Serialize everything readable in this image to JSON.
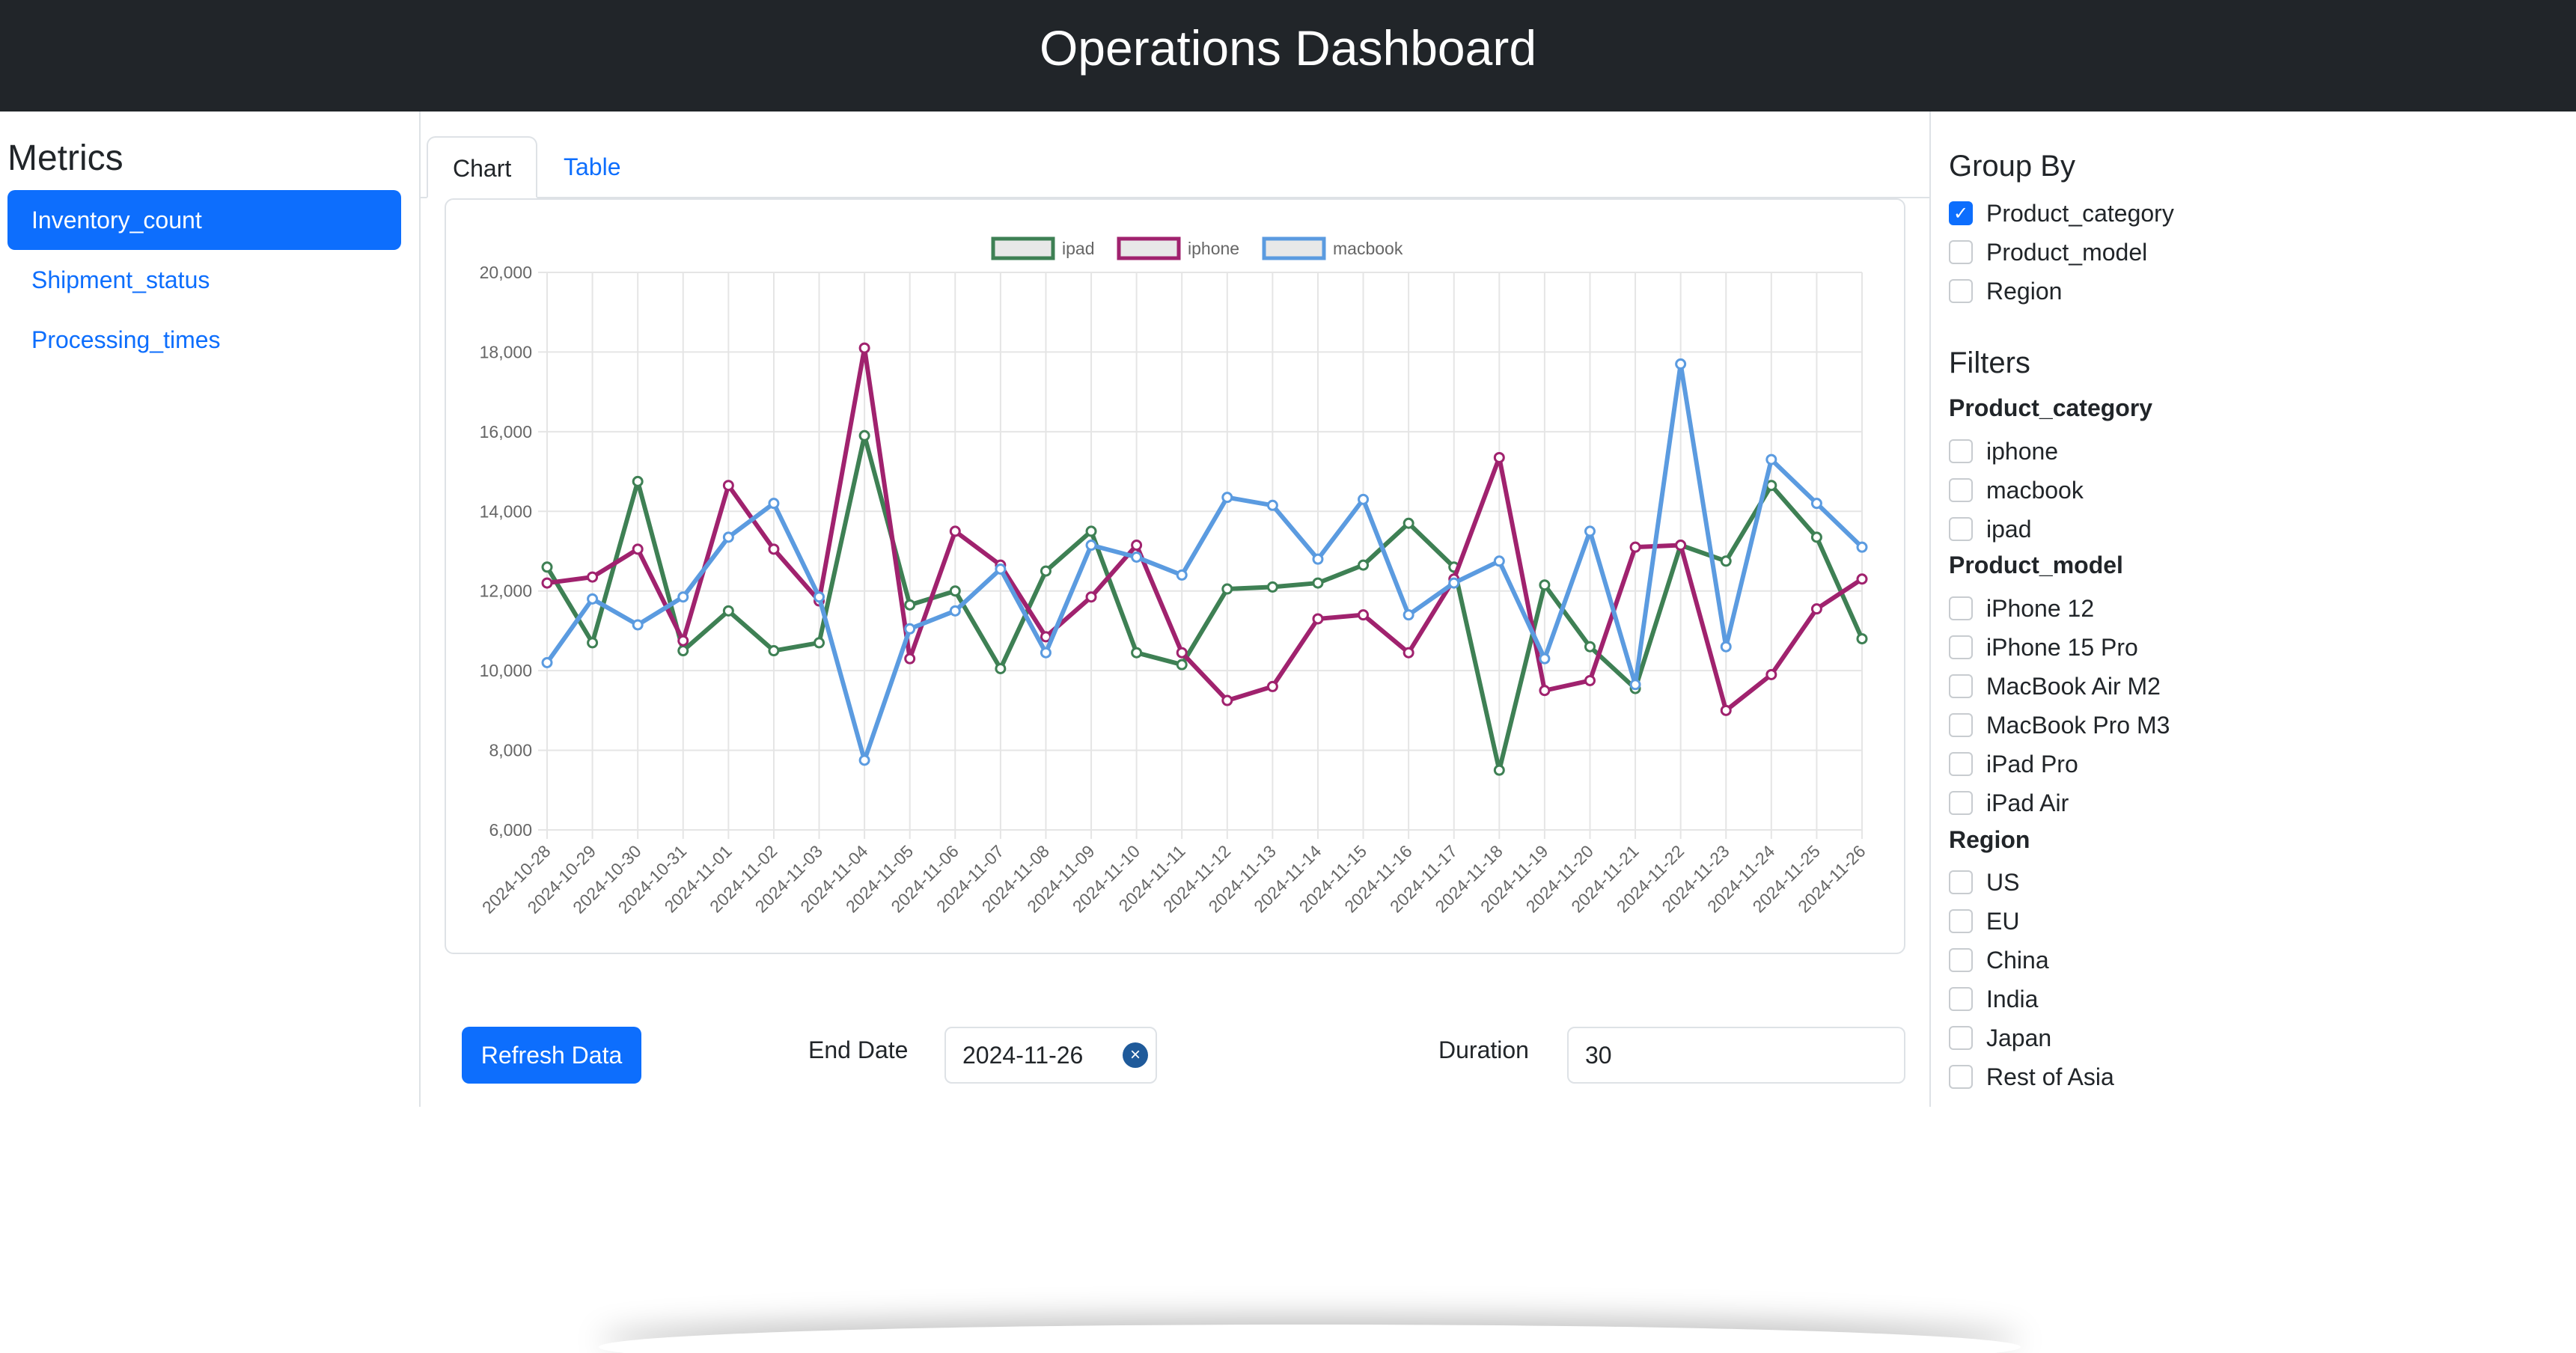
{
  "header": {
    "title": "Operations Dashboard"
  },
  "sidebar": {
    "heading": "Metrics",
    "items": [
      {
        "label": "Inventory_count",
        "active": true
      },
      {
        "label": "Shipment_status",
        "active": false
      },
      {
        "label": "Processing_times",
        "active": false
      }
    ]
  },
  "tabs": [
    {
      "label": "Chart",
      "active": true
    },
    {
      "label": "Table",
      "active": false
    }
  ],
  "controls": {
    "refresh_label": "Refresh Data",
    "end_date_label": "End Date",
    "end_date_value": "2024-11-26",
    "duration_label": "Duration",
    "duration_value": "30"
  },
  "group_by": {
    "title": "Group By",
    "options": [
      {
        "label": "Product_category",
        "checked": true
      },
      {
        "label": "Product_model",
        "checked": false
      },
      {
        "label": "Region",
        "checked": false
      }
    ]
  },
  "filters": {
    "title": "Filters",
    "groups": [
      {
        "name": "Product_category",
        "options": [
          "iphone",
          "macbook",
          "ipad"
        ]
      },
      {
        "name": "Product_model",
        "options": [
          "iPhone 12",
          "iPhone 15 Pro",
          "MacBook Air M2",
          "MacBook Pro M3",
          "iPad Pro",
          "iPad Air"
        ]
      },
      {
        "name": "Region",
        "options": [
          "US",
          "EU",
          "China",
          "India",
          "Japan",
          "Rest of Asia"
        ]
      }
    ]
  },
  "chart_data": {
    "type": "line",
    "legend_position": "top-center",
    "grid": true,
    "ylim": [
      6000,
      20000
    ],
    "y_ticks": [
      "6,000",
      "8,000",
      "10,000",
      "12,000",
      "14,000",
      "16,000",
      "18,000",
      "20,000"
    ],
    "y_tick_values": [
      6000,
      8000,
      10000,
      12000,
      14000,
      16000,
      18000,
      20000
    ],
    "x": [
      "2024-10-28",
      "2024-10-29",
      "2024-10-30",
      "2024-10-31",
      "2024-11-01",
      "2024-11-02",
      "2024-11-03",
      "2024-11-04",
      "2024-11-05",
      "2024-11-06",
      "2024-11-07",
      "2024-11-08",
      "2024-11-09",
      "2024-11-10",
      "2024-11-11",
      "2024-11-12",
      "2024-11-13",
      "2024-11-14",
      "2024-11-15",
      "2024-11-16",
      "2024-11-17",
      "2024-11-18",
      "2024-11-19",
      "2024-11-20",
      "2024-11-21",
      "2024-11-22",
      "2024-11-23",
      "2024-11-24",
      "2024-11-25",
      "2024-11-26"
    ],
    "series": [
      {
        "name": "ipad",
        "color": "#3e8054",
        "values": [
          12600,
          10700,
          14750,
          10500,
          11500,
          10500,
          10700,
          15900,
          11650,
          12000,
          10050,
          12500,
          13500,
          10450,
          10150,
          12050,
          12100,
          12200,
          12650,
          13700,
          12600,
          7500,
          12150,
          10600,
          9550,
          13150,
          12750,
          14650,
          13350,
          10800
        ]
      },
      {
        "name": "iphone",
        "color": "#a0226e",
        "values": [
          12200,
          12350,
          13050,
          10750,
          14650,
          13050,
          11750,
          18100,
          10300,
          13500,
          12650,
          10850,
          11850,
          13150,
          10450,
          9250,
          9600,
          11300,
          11400,
          10450,
          12300,
          15350,
          9500,
          9750,
          13100,
          13150,
          9000,
          9900,
          11550,
          12300
        ]
      },
      {
        "name": "macbook",
        "color": "#5b9be0",
        "values": [
          10200,
          11800,
          11150,
          11850,
          13350,
          14200,
          11850,
          7750,
          11050,
          11500,
          12550,
          10450,
          13150,
          12850,
          12400,
          14350,
          14150,
          12800,
          14300,
          11400,
          12200,
          12750,
          10300,
          13500,
          9650,
          17700,
          10600,
          15300,
          14200,
          13100
        ]
      }
    ]
  }
}
